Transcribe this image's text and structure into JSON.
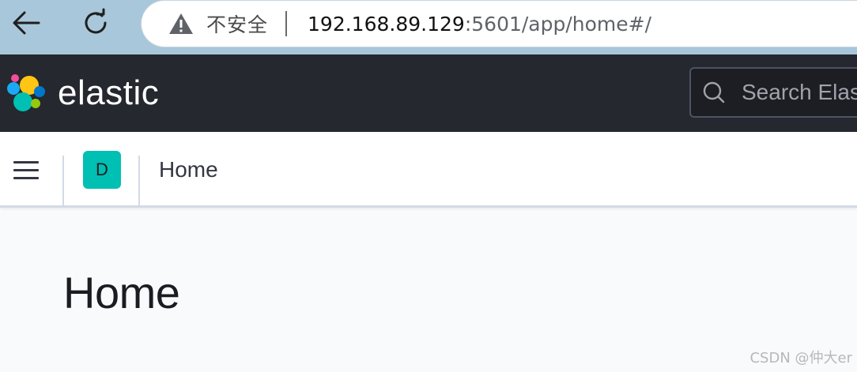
{
  "browser": {
    "security_label": "不安全",
    "url_host": "192.168.89.129",
    "url_rest": ":5601/app/home#/",
    "icons": {
      "back": "arrow-left-icon",
      "reload": "reload-icon",
      "warning": "warning-triangle-icon"
    }
  },
  "header": {
    "brand": "elastic",
    "search": {
      "placeholder": "Search Elas"
    },
    "icons": {
      "logo": "elastic-logo-icon",
      "search": "search-icon"
    }
  },
  "subnav": {
    "space_initial": "D",
    "breadcrumb": "Home",
    "icons": {
      "menu": "hamburger-menu-icon"
    }
  },
  "main": {
    "title": "Home"
  },
  "watermark": "CSDN @仲大er",
  "colors": {
    "browser_bar": "#a8c7da",
    "header_bg": "#25282f",
    "space_avatar": "#00bfb3",
    "page_bg": "#f9fafc"
  }
}
